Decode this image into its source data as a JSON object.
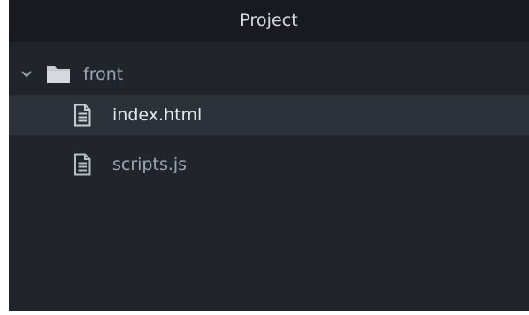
{
  "panel": {
    "title": "Project"
  },
  "tree": {
    "folder": {
      "label": "front",
      "expanded": true,
      "icon": "folder-icon",
      "chevron": "chevron-down-icon"
    },
    "files": [
      {
        "label": "index.html",
        "selected": true,
        "icon": "file-text-icon"
      },
      {
        "label": "scripts.js",
        "selected": false,
        "icon": "file-text-icon"
      }
    ]
  },
  "colors": {
    "panel_bg": "#21252b",
    "header_bg": "#181a1f",
    "selected_row": "#2c313a",
    "text": "#9da5b4",
    "text_selected": "#e4e7eb"
  }
}
